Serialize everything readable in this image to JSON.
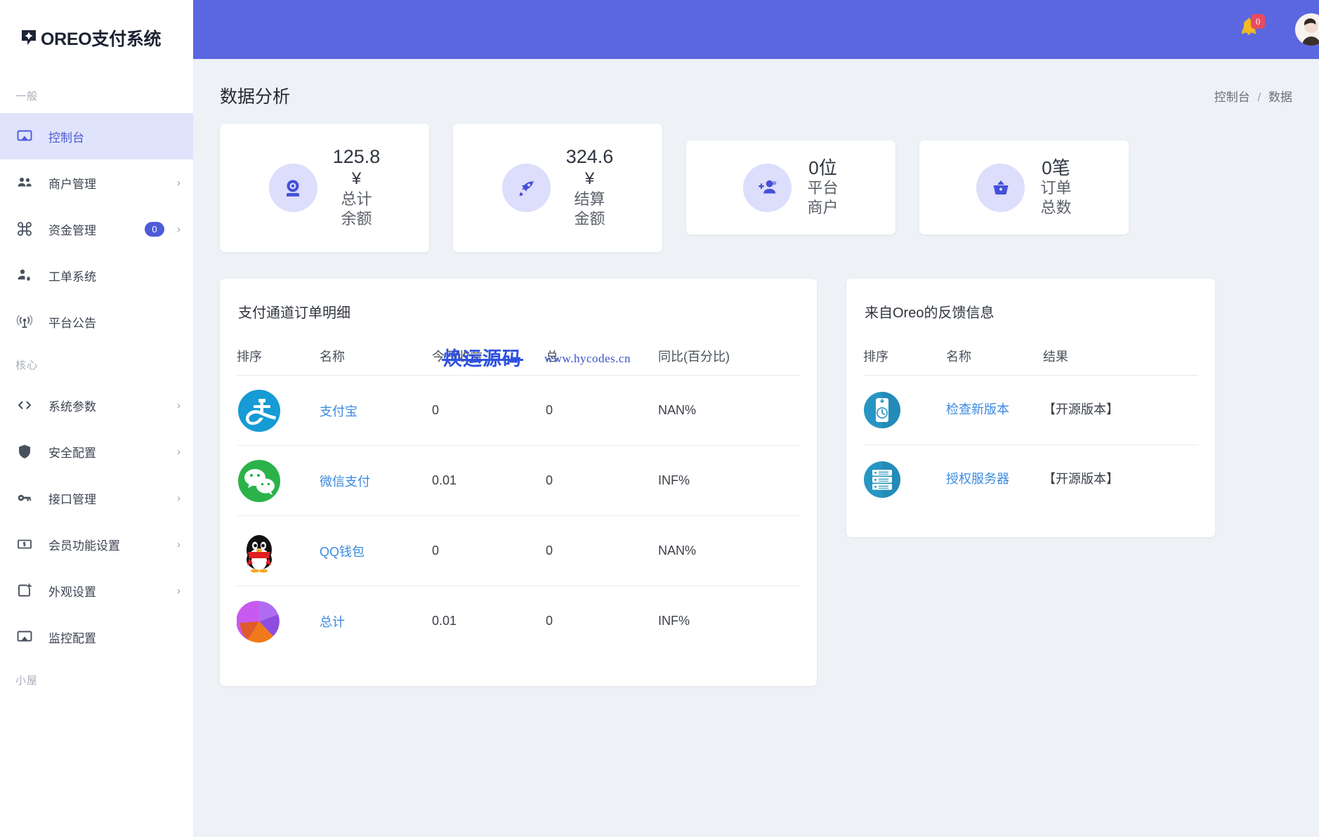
{
  "brand": {
    "name": "OREO支付系统",
    "logo_icon": "oreo-badge-icon"
  },
  "sidebar": {
    "groups": [
      {
        "label": "一般",
        "items": [
          {
            "label": "控制台",
            "icon": "monitor-icon",
            "active": true,
            "chevron": false,
            "badge": null
          },
          {
            "label": "商户管理",
            "icon": "users-icon",
            "active": false,
            "chevron": true,
            "badge": null
          },
          {
            "label": "资金管理",
            "icon": "command-icon",
            "active": false,
            "chevron": true,
            "badge": "0"
          },
          {
            "label": "工单系统",
            "icon": "user-cog-icon",
            "active": false,
            "chevron": false,
            "badge": null
          },
          {
            "label": "平台公告",
            "icon": "broadcast-icon",
            "active": false,
            "chevron": false,
            "badge": null
          }
        ]
      },
      {
        "label": "核心",
        "items": [
          {
            "label": "系统参数",
            "icon": "code-icon",
            "active": false,
            "chevron": true,
            "badge": null
          },
          {
            "label": "安全配置",
            "icon": "shield-icon",
            "active": false,
            "chevron": true,
            "badge": null
          },
          {
            "label": "接口管理",
            "icon": "key-icon",
            "active": false,
            "chevron": true,
            "badge": null
          },
          {
            "label": "会员功能设置",
            "icon": "money-note-icon",
            "active": false,
            "chevron": true,
            "badge": null
          },
          {
            "label": "外观设置",
            "icon": "layout-plus-icon",
            "active": false,
            "chevron": true,
            "badge": null
          },
          {
            "label": "监控配置",
            "icon": "monitor-icon",
            "active": false,
            "chevron": false,
            "badge": null
          }
        ]
      },
      {
        "label": "小屋",
        "items": []
      }
    ]
  },
  "topbar": {
    "bell_icon": "bell-icon",
    "bell_badge": "0",
    "avatar_icon": "user-avatar"
  },
  "page": {
    "title": "数据分析",
    "breadcrumb": {
      "root": "控制台",
      "separator": "/",
      "current": "数据"
    }
  },
  "stats": [
    {
      "value": "125.8",
      "currency": "¥",
      "label_line1": "总计",
      "label_line2": "余额",
      "icon": "camera-circle-icon",
      "layout": "tall"
    },
    {
      "value": "324.6",
      "currency": "¥",
      "label_line1": "结算",
      "label_line2": "金额",
      "icon": "rocket-icon",
      "layout": "tall"
    },
    {
      "value": "0位",
      "currency": "",
      "label_line1": "平台",
      "label_line2": "商户",
      "icon": "add-user-icon",
      "layout": "short"
    },
    {
      "value": "0笔",
      "currency": "",
      "label_line1": "订单",
      "label_line2": "总数",
      "icon": "basket-icon",
      "layout": "short"
    }
  ],
  "channel_panel": {
    "title": "支付通道订单明细",
    "columns": [
      "排序",
      "名称",
      "今日收益",
      "总",
      "同比(百分比)"
    ],
    "rows": [
      {
        "icon": "alipay-icon",
        "name": "支付宝",
        "today": "0",
        "total": "0",
        "ratio": "NAN%"
      },
      {
        "icon": "wechat-icon",
        "name": "微信支付",
        "today": "0.01",
        "total": "0",
        "ratio": "INF%"
      },
      {
        "icon": "qq-icon",
        "name": "QQ钱包",
        "today": "0",
        "total": "0",
        "ratio": "NAN%"
      },
      {
        "icon": "pie-icon",
        "name": "总计",
        "today": "0.01",
        "total": "0",
        "ratio": "INF%"
      }
    ]
  },
  "feedback_panel": {
    "title": "来自Oreo的反馈信息",
    "columns": [
      "排序",
      "名称",
      "结果"
    ],
    "rows": [
      {
        "icon": "update-clock-icon",
        "name": "检查新版本",
        "result": "【开源版本】"
      },
      {
        "icon": "server-icon",
        "name": "授权服务器",
        "result": "【开源版本】"
      }
    ]
  },
  "watermark": {
    "text_cn": "焕运源码",
    "url": "www.hycodes.cn"
  }
}
